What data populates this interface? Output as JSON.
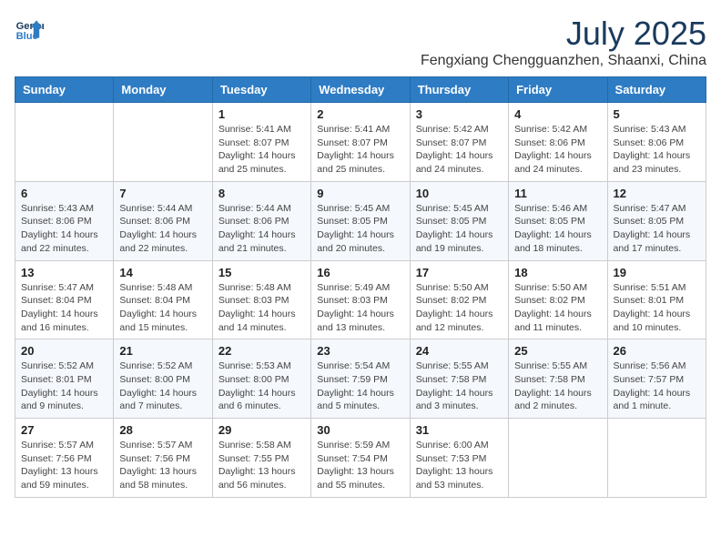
{
  "header": {
    "logo_line1": "General",
    "logo_line2": "Blue",
    "month_title": "July 2025",
    "location": "Fengxiang Chengguanzhen, Shaanxi, China"
  },
  "weekdays": [
    "Sunday",
    "Monday",
    "Tuesday",
    "Wednesday",
    "Thursday",
    "Friday",
    "Saturday"
  ],
  "weeks": [
    [
      {
        "day": "",
        "info": ""
      },
      {
        "day": "",
        "info": ""
      },
      {
        "day": "1",
        "info": "Sunrise: 5:41 AM\nSunset: 8:07 PM\nDaylight: 14 hours and 25 minutes."
      },
      {
        "day": "2",
        "info": "Sunrise: 5:41 AM\nSunset: 8:07 PM\nDaylight: 14 hours and 25 minutes."
      },
      {
        "day": "3",
        "info": "Sunrise: 5:42 AM\nSunset: 8:07 PM\nDaylight: 14 hours and 24 minutes."
      },
      {
        "day": "4",
        "info": "Sunrise: 5:42 AM\nSunset: 8:06 PM\nDaylight: 14 hours and 24 minutes."
      },
      {
        "day": "5",
        "info": "Sunrise: 5:43 AM\nSunset: 8:06 PM\nDaylight: 14 hours and 23 minutes."
      }
    ],
    [
      {
        "day": "6",
        "info": "Sunrise: 5:43 AM\nSunset: 8:06 PM\nDaylight: 14 hours and 22 minutes."
      },
      {
        "day": "7",
        "info": "Sunrise: 5:44 AM\nSunset: 8:06 PM\nDaylight: 14 hours and 22 minutes."
      },
      {
        "day": "8",
        "info": "Sunrise: 5:44 AM\nSunset: 8:06 PM\nDaylight: 14 hours and 21 minutes."
      },
      {
        "day": "9",
        "info": "Sunrise: 5:45 AM\nSunset: 8:05 PM\nDaylight: 14 hours and 20 minutes."
      },
      {
        "day": "10",
        "info": "Sunrise: 5:45 AM\nSunset: 8:05 PM\nDaylight: 14 hours and 19 minutes."
      },
      {
        "day": "11",
        "info": "Sunrise: 5:46 AM\nSunset: 8:05 PM\nDaylight: 14 hours and 18 minutes."
      },
      {
        "day": "12",
        "info": "Sunrise: 5:47 AM\nSunset: 8:05 PM\nDaylight: 14 hours and 17 minutes."
      }
    ],
    [
      {
        "day": "13",
        "info": "Sunrise: 5:47 AM\nSunset: 8:04 PM\nDaylight: 14 hours and 16 minutes."
      },
      {
        "day": "14",
        "info": "Sunrise: 5:48 AM\nSunset: 8:04 PM\nDaylight: 14 hours and 15 minutes."
      },
      {
        "day": "15",
        "info": "Sunrise: 5:48 AM\nSunset: 8:03 PM\nDaylight: 14 hours and 14 minutes."
      },
      {
        "day": "16",
        "info": "Sunrise: 5:49 AM\nSunset: 8:03 PM\nDaylight: 14 hours and 13 minutes."
      },
      {
        "day": "17",
        "info": "Sunrise: 5:50 AM\nSunset: 8:02 PM\nDaylight: 14 hours and 12 minutes."
      },
      {
        "day": "18",
        "info": "Sunrise: 5:50 AM\nSunset: 8:02 PM\nDaylight: 14 hours and 11 minutes."
      },
      {
        "day": "19",
        "info": "Sunrise: 5:51 AM\nSunset: 8:01 PM\nDaylight: 14 hours and 10 minutes."
      }
    ],
    [
      {
        "day": "20",
        "info": "Sunrise: 5:52 AM\nSunset: 8:01 PM\nDaylight: 14 hours and 9 minutes."
      },
      {
        "day": "21",
        "info": "Sunrise: 5:52 AM\nSunset: 8:00 PM\nDaylight: 14 hours and 7 minutes."
      },
      {
        "day": "22",
        "info": "Sunrise: 5:53 AM\nSunset: 8:00 PM\nDaylight: 14 hours and 6 minutes."
      },
      {
        "day": "23",
        "info": "Sunrise: 5:54 AM\nSunset: 7:59 PM\nDaylight: 14 hours and 5 minutes."
      },
      {
        "day": "24",
        "info": "Sunrise: 5:55 AM\nSunset: 7:58 PM\nDaylight: 14 hours and 3 minutes."
      },
      {
        "day": "25",
        "info": "Sunrise: 5:55 AM\nSunset: 7:58 PM\nDaylight: 14 hours and 2 minutes."
      },
      {
        "day": "26",
        "info": "Sunrise: 5:56 AM\nSunset: 7:57 PM\nDaylight: 14 hours and 1 minute."
      }
    ],
    [
      {
        "day": "27",
        "info": "Sunrise: 5:57 AM\nSunset: 7:56 PM\nDaylight: 13 hours and 59 minutes."
      },
      {
        "day": "28",
        "info": "Sunrise: 5:57 AM\nSunset: 7:56 PM\nDaylight: 13 hours and 58 minutes."
      },
      {
        "day": "29",
        "info": "Sunrise: 5:58 AM\nSunset: 7:55 PM\nDaylight: 13 hours and 56 minutes."
      },
      {
        "day": "30",
        "info": "Sunrise: 5:59 AM\nSunset: 7:54 PM\nDaylight: 13 hours and 55 minutes."
      },
      {
        "day": "31",
        "info": "Sunrise: 6:00 AM\nSunset: 7:53 PM\nDaylight: 13 hours and 53 minutes."
      },
      {
        "day": "",
        "info": ""
      },
      {
        "day": "",
        "info": ""
      }
    ]
  ]
}
